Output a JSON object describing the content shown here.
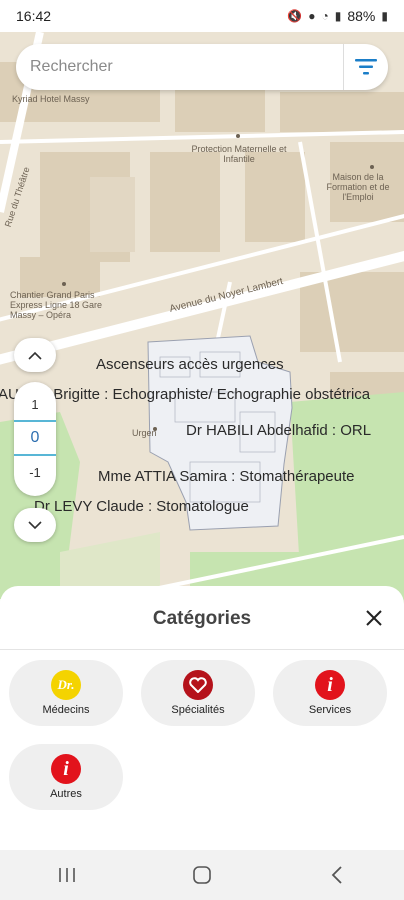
{
  "status_bar": {
    "time": "16:42",
    "battery": "88%"
  },
  "search": {
    "placeholder": "Rechercher"
  },
  "map": {
    "street_labels": [
      "Kyriad Hotel Massy",
      "Protection Maternelle et Infantile",
      "Maison de la Formation et de l'Emploi",
      "Rue du Théâtre",
      "Chantier Grand Paris Express Ligne 18 Gare Massy – Opéra",
      "Avenue du Noyer Lambert",
      "Urgen"
    ],
    "poi_labels": [
      "Ascenseurs accès urgences",
      "AUBRY Brigitte : Echographiste/ Echographie obstétrica",
      "Dr HABILI Abdelhafid : ORL",
      "Mme ATTIA Samira : Stomathérapeute",
      "Dr LEVY Claude : Stomatologue"
    ]
  },
  "floors": {
    "up": "1",
    "current": "0",
    "down": "-1"
  },
  "sheet": {
    "title": "Catégories",
    "categories": [
      {
        "label": "Médecins",
        "icon": "doctor-icon",
        "color": "#f4d300"
      },
      {
        "label": "Spécialités",
        "icon": "heart-icon",
        "color": "#b5121b"
      },
      {
        "label": "Services",
        "icon": "info-icon",
        "color": "#e2131c"
      },
      {
        "label": "Autres",
        "icon": "info-icon",
        "color": "#e2131c"
      }
    ],
    "doctor_badge": "Dr."
  },
  "colors": {
    "accent": "#1b7ec8",
    "map_bg": "#ebe3d3",
    "building": "#d9cdb6",
    "green": "#c6e4b0"
  }
}
